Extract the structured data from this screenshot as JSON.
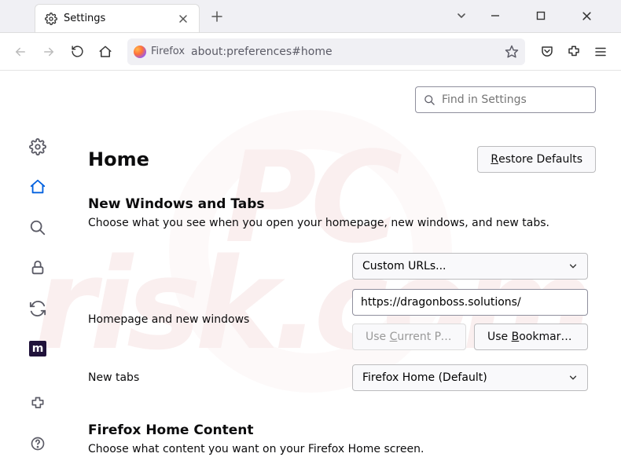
{
  "tab": {
    "label": "Settings"
  },
  "navbar": {
    "identity_label": "Firefox",
    "url": "about:preferences#home"
  },
  "find": {
    "placeholder": "Find in Settings"
  },
  "page": {
    "heading": "Home",
    "restore_button": "Restore Defaults",
    "section1": {
      "title": "New Windows and Tabs",
      "desc": "Choose what you see when you open your homepage, new windows, and new tabs.",
      "homepage_label": "Homepage and new windows",
      "homepage_select": "Custom URLs...",
      "homepage_url": "https://dragonboss.solutions/",
      "use_current": "Use Current Pages",
      "use_bookmark": "Use Bookmark…",
      "newtabs_label": "New tabs",
      "newtabs_select": "Firefox Home (Default)"
    },
    "section2": {
      "title": "Firefox Home Content",
      "desc": "Choose what content you want on your Firefox Home screen."
    }
  }
}
